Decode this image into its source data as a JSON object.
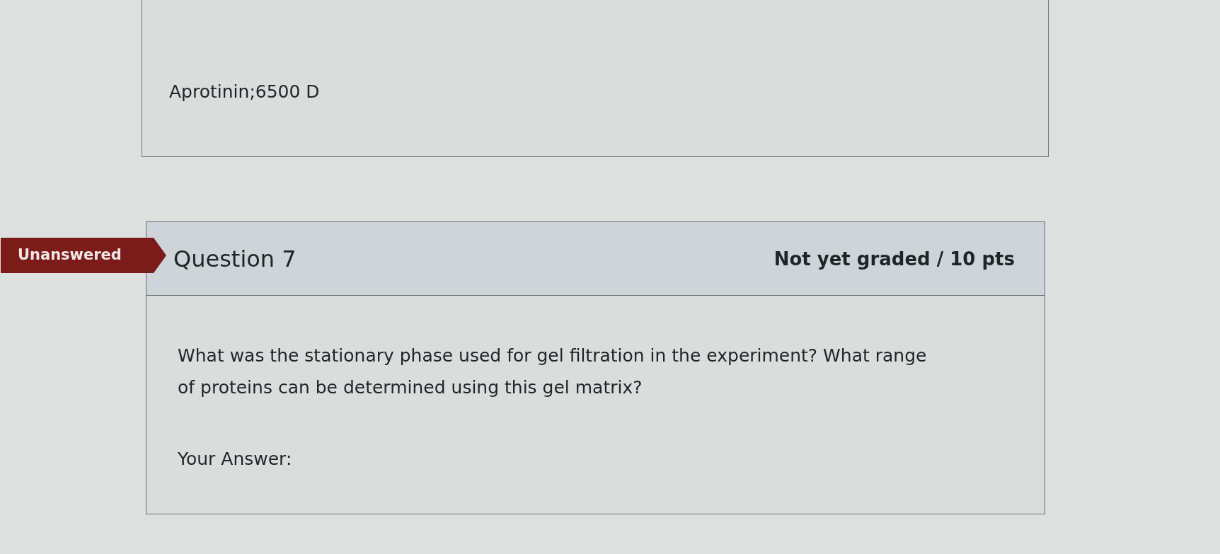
{
  "previous_answer": {
    "text": "Aprotinin;6500 D"
  },
  "question": {
    "status": "Unanswered",
    "title": "Question 7",
    "points": "Not yet graded / 10 pts",
    "text": "What was the stationary phase used for gel filtration in the experiment? What range of proteins can be determined using this gel matrix?",
    "answer_label": "Your Answer:"
  }
}
